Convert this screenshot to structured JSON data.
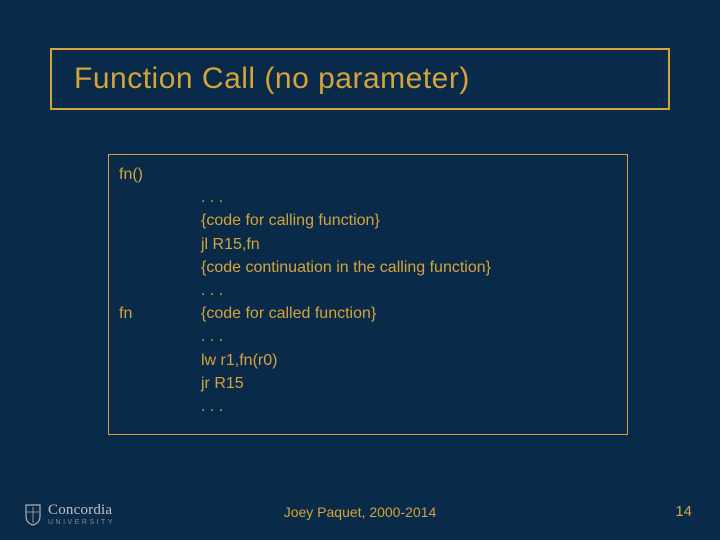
{
  "title": "Function Call (no parameter)",
  "code": {
    "rows": [
      {
        "label": "fn()",
        "text": ""
      },
      {
        "label": "",
        "text": ". . ."
      },
      {
        "label": "",
        "text": "{code for calling function}"
      },
      {
        "label": "",
        "text": "jl R15,fn"
      },
      {
        "label": "",
        "text": "{code continuation in the calling function}"
      },
      {
        "label": "",
        "text": ". . ."
      },
      {
        "label": "fn",
        "text": "{code for called function}"
      },
      {
        "label": "",
        "text": ". . ."
      },
      {
        "label": "",
        "text": "lw r1,fn(r0)"
      },
      {
        "label": "",
        "text": "jr R15"
      },
      {
        "label": "",
        "text": ". . ."
      }
    ]
  },
  "footer": "Joey Paquet, 2000-2014",
  "page_number": "14",
  "brand": {
    "name": "Concordia",
    "sub": "UNIVERSITY"
  },
  "colors": {
    "bg": "#0a2a4a",
    "accent": "#d4a43a"
  }
}
